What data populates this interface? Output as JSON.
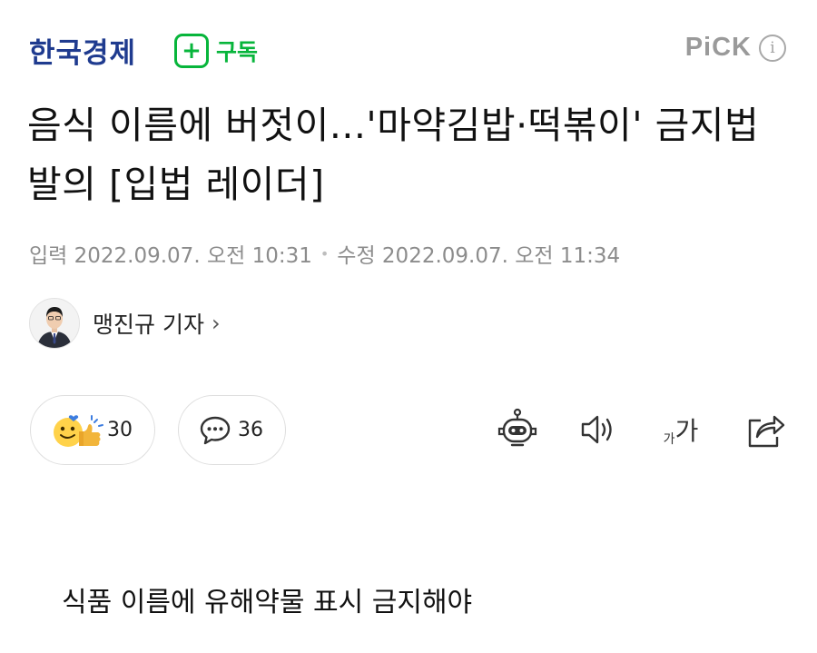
{
  "header": {
    "press_logo": "한국경제",
    "subscribe_label": "구독",
    "subscribe_icon": "plus-icon",
    "pick_label": "PiCK",
    "info_icon_text": "i",
    "accent_color": "#07b53b",
    "logo_color": "#1f3b8f"
  },
  "article": {
    "title": "음식 이름에 버젓이...'마약김밥·떡볶이' 금지법 발의 [입법 레이더]",
    "input_date": "입력 2022.09.07. 오전 10:31",
    "modified_date": "수정 2022.09.07. 오전 11:34",
    "reporter_name": "맹진규 기자",
    "reporter_chevron": "›",
    "subheading": "식품 이름에 유해약물 표시 금지해야"
  },
  "reactions": {
    "like_count": "30",
    "comment_count": "36"
  },
  "toolbar": {
    "icons": [
      "robot-summary-icon",
      "speaker-icon",
      "font-size-icon",
      "share-icon"
    ],
    "font_small": "가",
    "font_big": "가"
  }
}
